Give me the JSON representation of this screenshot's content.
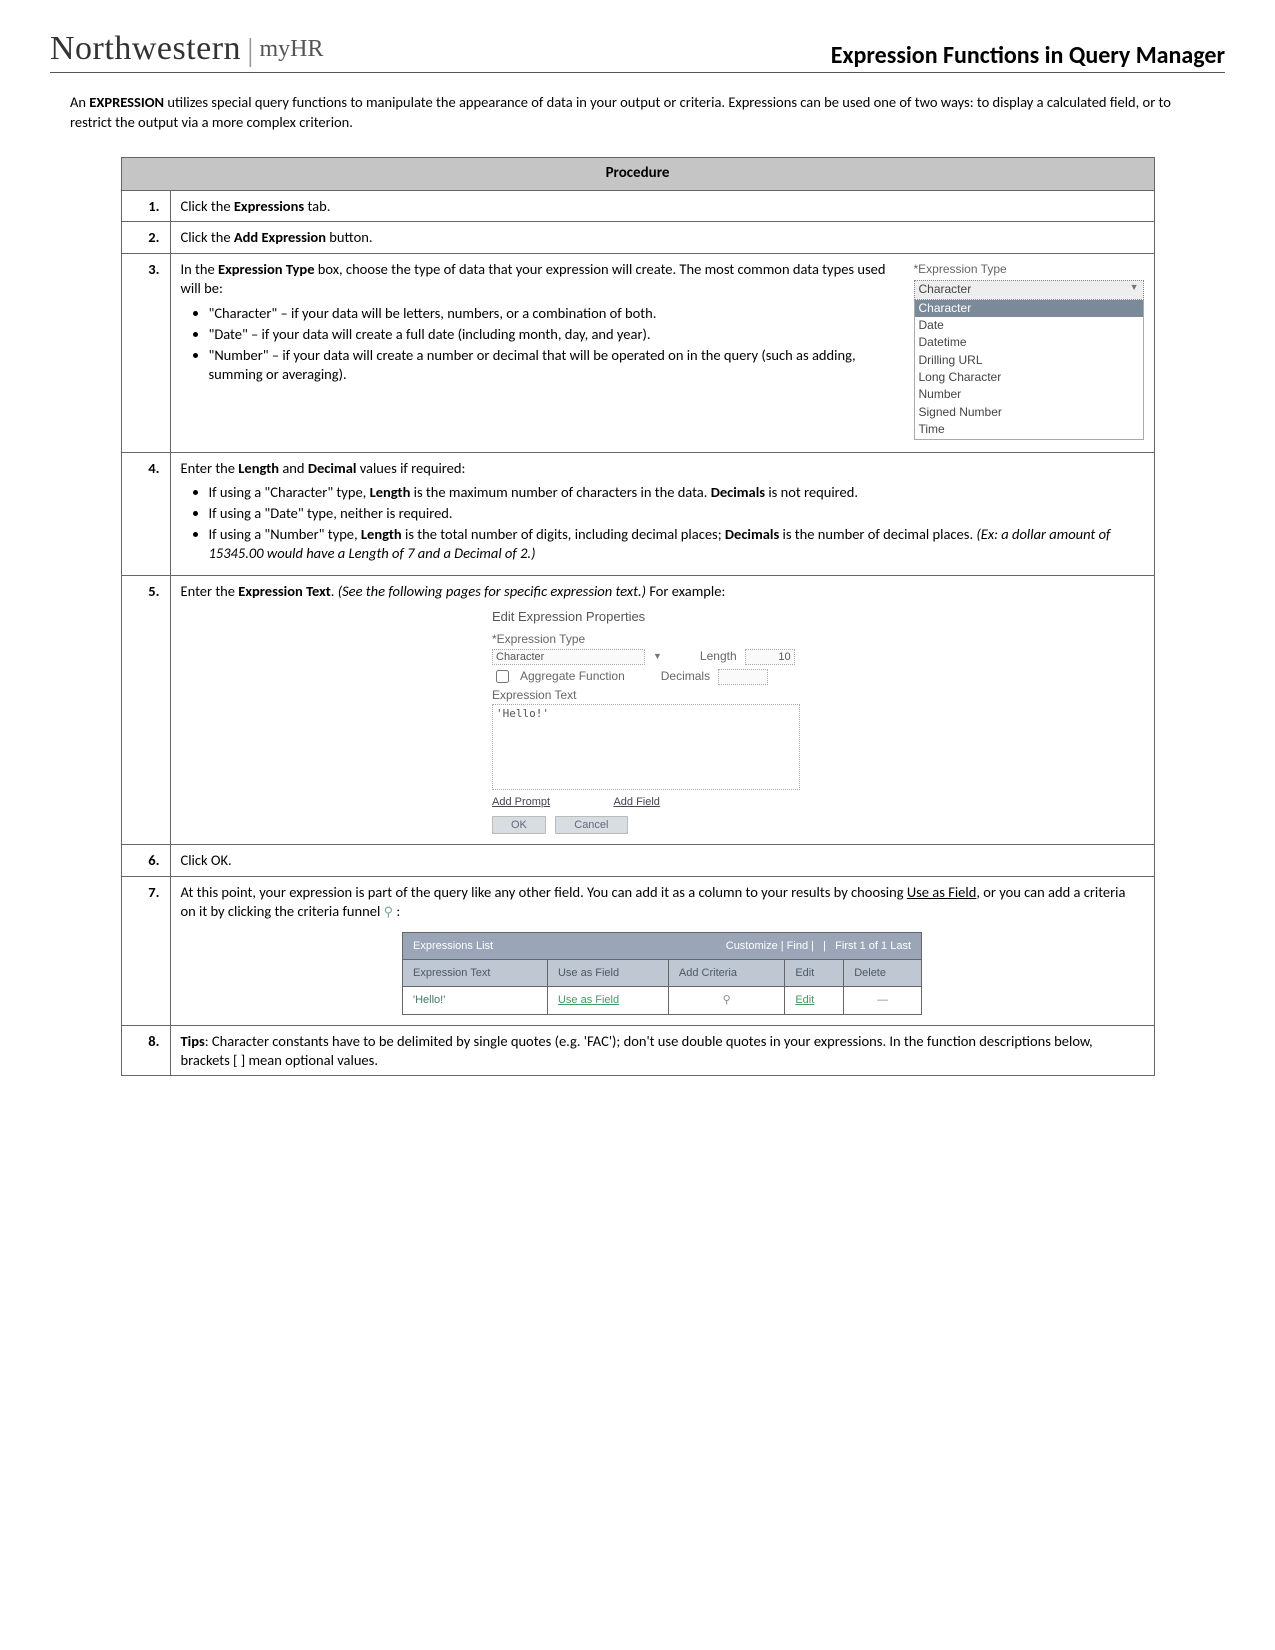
{
  "brand": {
    "main": "Northwestern",
    "sub": "myHR"
  },
  "page_title": "Expression Functions in Query Manager",
  "intro_a": "An ",
  "intro_b": "EXPRESSION",
  "intro_c": " utilizes special query functions to manipulate the appearance of data in your output or criteria. Expressions can be used one of two ways: to display a calculated field, or to restrict the output via a more complex criterion.",
  "proc_header": "Procedure",
  "steps": {
    "s1": {
      "n": "1.",
      "a": "Click the ",
      "b": "Expressions",
      "c": " tab."
    },
    "s2": {
      "n": "2.",
      "a": "Click the ",
      "b": "Add Expression",
      "c": " button."
    },
    "s3": {
      "n": "3.",
      "a": "In the ",
      "b": "Expression Type",
      "c": " box, choose the type of data that your expression will create. The most common data types used will be:",
      "li1": "\"Character\" – if your data will be letters, numbers, or a combination of both.",
      "li2": "\"Date\" – if your data will create a full date (including month, day, and year).",
      "li3": "\"Number\" – if your data will create a number or decimal that will be operated on in the query (such as adding, summing or averaging).",
      "img": {
        "label": "*Expression Type",
        "selected": "Character",
        "opts": [
          "Character",
          "Date",
          "Datetime",
          "Drilling URL",
          "Long Character",
          "Number",
          "Signed Number",
          "Time"
        ]
      }
    },
    "s4": {
      "n": "4.",
      "a": "Enter the ",
      "b1": "Length",
      "mid": " and ",
      "b2": "Decimal",
      "c": " values if required:",
      "li1a": "If using a \"Character\" type, ",
      "li1b": "Length",
      "li1c": " is the maximum number of characters in the data. ",
      "li1d": "Decimals",
      "li1e": " is not required.",
      "li2": "If using a \"Date\" type, neither is required.",
      "li3a": "If using a \"Number\" type, ",
      "li3b": "Length",
      "li3c": " is the total number of digits, including decimal places; ",
      "li3d": "Decimals",
      "li3e": " is the number of decimal places. ",
      "li3f": "(Ex: a dollar amount of 15345.00 would have a Length of 7 and a Decimal of 2.)"
    },
    "s5": {
      "n": "5.",
      "a": "Enter the ",
      "b": "Expression Text",
      "c": ".  ",
      "it": "(See the following pages for specific expression text.)",
      "d": " For example:",
      "img": {
        "title": "Edit Expression Properties",
        "type_lbl": "*Expression Type",
        "type_val": "Character",
        "len_lbl": "Length",
        "len_val": "10",
        "dec_lbl": "Decimals",
        "agg": "Aggregate Function",
        "text_lbl": "Expression Text",
        "text_val": "'Hello!'",
        "link1": "Add Prompt",
        "link2": "Add Field",
        "btn_ok": "OK",
        "btn_cancel": "Cancel"
      }
    },
    "s6": {
      "n": "6.",
      "a": "Click OK."
    },
    "s7": {
      "n": "7.",
      "a": "At this point, your expression is part of the query like any other field. You can add it as a column to your results by choosing ",
      "link": "Use as Field",
      "b": ", or you can add a criteria on it by clicking the criteria funnel ",
      "c": " :",
      "img": {
        "bar_left": "Expressions List",
        "bar_right": "Customize | Find |    |     First  1 of 1  Last",
        "h1": "Expression Text",
        "h2": "Use as Field",
        "h3": "Add Criteria",
        "h4": "Edit",
        "h5": "Delete",
        "r1": "'Hello!'",
        "r2": "Use as Field",
        "r3": "⚲",
        "r4": "Edit",
        "r5": "—"
      }
    },
    "s8": {
      "n": "8.",
      "a": "Tips",
      "b": ": Character constants have to be delimited by single quotes (e.g. 'FAC'); don't use double quotes in your expressions. In the function descriptions below, brackets [ ] mean optional values."
    }
  }
}
